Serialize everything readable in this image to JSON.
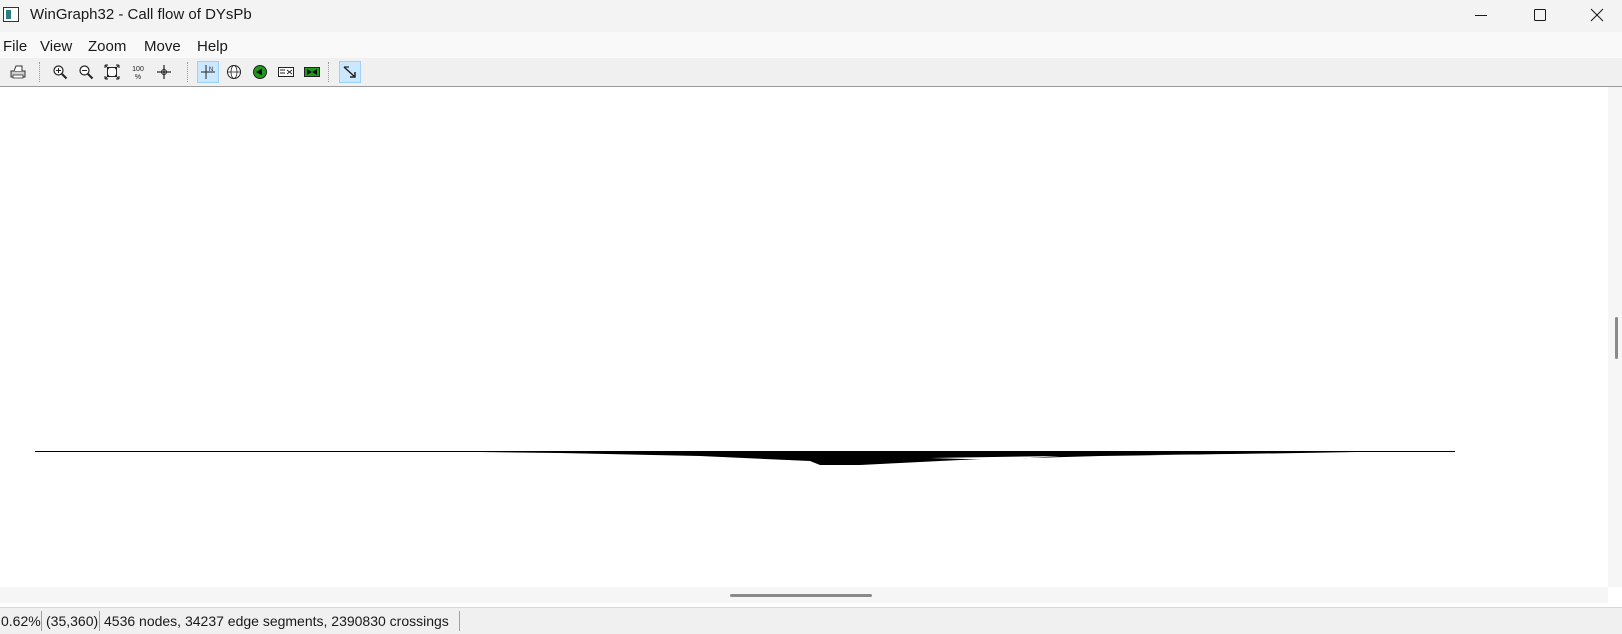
{
  "window": {
    "title": "WinGraph32 - Call flow of DYsPb",
    "app_icon": "wingraph-app-icon",
    "controls": [
      "minimize-icon",
      "maximize-icon",
      "close-icon"
    ]
  },
  "menu": {
    "items": [
      {
        "label": "File"
      },
      {
        "label": "View"
      },
      {
        "label": "Zoom"
      },
      {
        "label": "Move"
      },
      {
        "label": "Help"
      }
    ]
  },
  "toolbar": {
    "buttons": [
      {
        "icon": "print-icon",
        "pressed": false
      },
      {
        "icon": "zoom-in-icon",
        "pressed": false
      },
      {
        "icon": "zoom-out-icon",
        "pressed": false
      },
      {
        "icon": "fit-window-icon",
        "pressed": false
      },
      {
        "icon": "zoom-100-icon",
        "label": "100 %",
        "pressed": false
      },
      {
        "icon": "center-icon",
        "pressed": false
      },
      {
        "icon": "layout-normal-icon",
        "pressed": true
      },
      {
        "icon": "fisheye-icon",
        "pressed": false
      },
      {
        "icon": "green-node-icon",
        "pressed": false
      },
      {
        "icon": "graph-fold-icon",
        "pressed": false
      },
      {
        "icon": "green-fold-icon",
        "pressed": false
      },
      {
        "icon": "follow-edge-icon",
        "pressed": true
      }
    ]
  },
  "graph": {
    "description_icon": "call-flow-graph"
  },
  "status": {
    "zoom": "0.62%",
    "position": "(35,360)",
    "info": "4536 nodes, 34237 edge segments, 2390830 crossings"
  },
  "colors": {
    "pressed_background": "#cce8ff",
    "graph_ink": "#000000",
    "node_green": "#1e9a1e"
  }
}
